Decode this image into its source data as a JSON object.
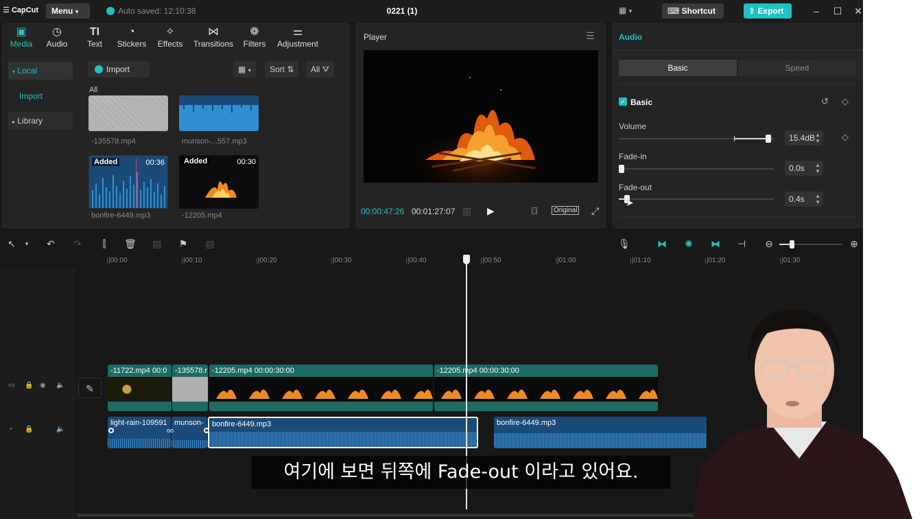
{
  "app": {
    "logo": "CapCut",
    "menu_label": "Menu",
    "autosave": "Auto saved: 12:10:38",
    "project_title": "0221 (1)",
    "shortcut_label": "Shortcut",
    "export_label": "Export"
  },
  "toolbar": {
    "tabs": [
      {
        "label": "Media",
        "icon": "media-icon"
      },
      {
        "label": "Audio",
        "icon": "audio-icon"
      },
      {
        "label": "Text",
        "icon": "text-icon"
      },
      {
        "label": "Stickers",
        "icon": "sticker-icon"
      },
      {
        "label": "Effects",
        "icon": "effects-icon"
      },
      {
        "label": "Transitions",
        "icon": "transitions-icon"
      },
      {
        "label": "Filters",
        "icon": "filters-icon"
      },
      {
        "label": "Adjustment",
        "icon": "adjustment-icon"
      }
    ]
  },
  "media": {
    "sidebar": {
      "local": "Local",
      "import": "Import",
      "library": "Library"
    },
    "import_label": "Import",
    "sort_label": "Sort",
    "filter_label": "All",
    "section_label": "All",
    "items": [
      {
        "name": "-135578.mp4",
        "badge": "",
        "duration": ""
      },
      {
        "name": "munson-...557.mp3",
        "badge": "",
        "duration": ""
      },
      {
        "name": "bonfire-6449.mp3",
        "badge": "Added",
        "duration": "00:36"
      },
      {
        "name": "-12205.mp4",
        "badge": "Added",
        "duration": "00:30"
      }
    ]
  },
  "player": {
    "title": "Player",
    "current_time": "00:00:47:26",
    "total_time": "00:01:27:07",
    "ratio_label": "Original"
  },
  "audio_panel": {
    "title": "Audio",
    "tabs": [
      "Basic",
      "Speed"
    ],
    "section": "Basic",
    "volume": {
      "label": "Volume",
      "value": "15.4dB"
    },
    "fade_in": {
      "label": "Fade-in",
      "value": "0.0s"
    },
    "fade_out": {
      "label": "Fade-out",
      "value": "0.4s"
    }
  },
  "timeline": {
    "ruler": [
      "|00:00",
      "|00:10",
      "|00:20",
      "|00:30",
      "|00:40",
      "|00:50",
      "|01:00",
      "|01:10",
      "|01:20",
      "|01:30"
    ],
    "video_clips": [
      {
        "title": "-11722.mp4  00:0"
      },
      {
        "title": "-135578.r"
      },
      {
        "title": "-12205.mp4  00:00:30:00"
      },
      {
        "title": "-12205.mp4  00:00:30:00"
      }
    ],
    "audio_clips": [
      {
        "title": "light-rain-109591"
      },
      {
        "title": "munson-"
      },
      {
        "title": "bonfire-6449.mp3"
      },
      {
        "title": "bonfire-6449.mp3"
      }
    ]
  },
  "subtitle": "여기에 보면 뒤쪽에 Fade-out 이라고 있어요."
}
